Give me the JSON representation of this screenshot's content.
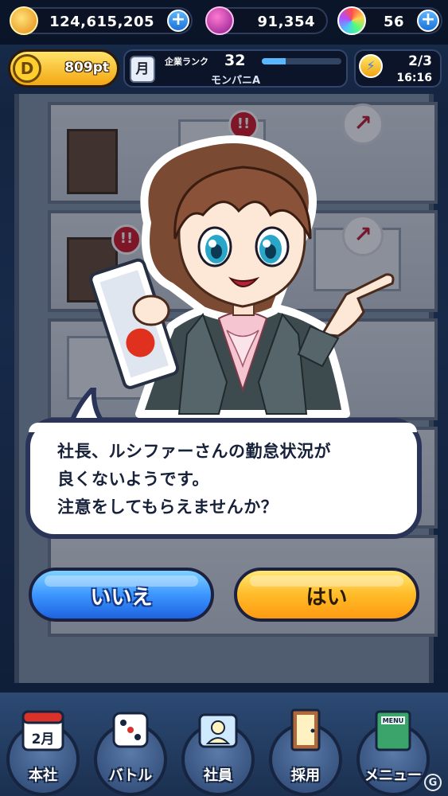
{
  "resources": {
    "coins": "124,615,205",
    "gems": "91,354",
    "orbs": "56"
  },
  "status": {
    "points": "809pt",
    "points_icon_letter": "D",
    "rank_badge": "月",
    "rank_label": "企業ランク",
    "rank_value": "32",
    "rank_progress": 0.3,
    "company_name": "モンパニA",
    "energy": "2/3",
    "timer": "16:16"
  },
  "building": {
    "alert_mark": "!!",
    "up_arrow": "↗"
  },
  "dialog": {
    "lines": [
      "社長、ルシファーさんの勤怠状況が",
      "良くないようです。",
      "注意をしてもらえませんか？"
    ]
  },
  "buttons": {
    "no": "いいえ",
    "yes": "はい"
  },
  "nav": {
    "items": [
      {
        "label": "本社",
        "icon": "calendar-icon",
        "badge": "2月"
      },
      {
        "label": "バトル",
        "icon": "dice-icon"
      },
      {
        "label": "社員",
        "icon": "employee-card-icon"
      },
      {
        "label": "採用",
        "icon": "door-icon"
      },
      {
        "label": "メニュー",
        "icon": "menu-book-icon",
        "badge": "MENU"
      }
    ]
  },
  "colors": {
    "accent_blue": "#3d96ff",
    "accent_orange": "#ffbb28",
    "alert_red": "#d61c2c"
  },
  "watermark": "G"
}
